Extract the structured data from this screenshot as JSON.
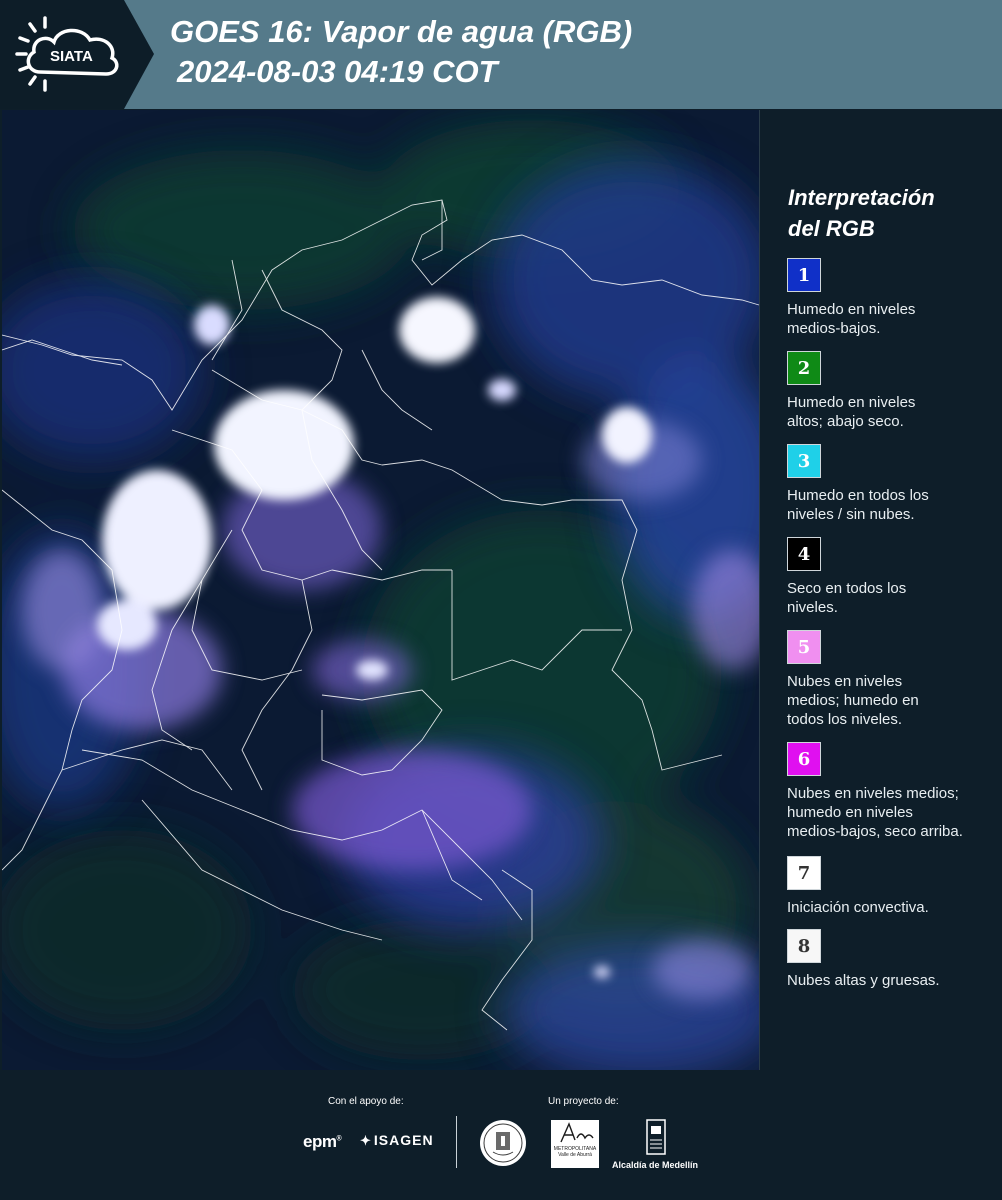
{
  "header": {
    "logo_text": "SIATA",
    "title_line1": "GOES 16: Vapor de agua (RGB)",
    "title_line2": "2024-08-03 04:19 COT"
  },
  "legend": {
    "title_line1": "Interpretación",
    "title_line2": "del RGB",
    "items": [
      {
        "number": "1",
        "color": "#1030c8",
        "text_color": "#ffffff",
        "line1": "Humedo en niveles",
        "line2": "medios-bajos.",
        "line3": ""
      },
      {
        "number": "2",
        "color": "#0f8a16",
        "text_color": "#ffffff",
        "line1": "Humedo en niveles",
        "line2": "altos; abajo seco.",
        "line3": ""
      },
      {
        "number": "3",
        "color": "#1fd0e8",
        "text_color": "#ffffff",
        "line1": "Humedo en todos los",
        "line2": "niveles / sin nubes.",
        "line3": ""
      },
      {
        "number": "4",
        "color": "#000000",
        "text_color": "#ffffff",
        "line1": "Seco en todos los",
        "line2": "niveles.",
        "line3": ""
      },
      {
        "number": "5",
        "color": "#f08ff0",
        "text_color": "#ffffff",
        "line1": "Nubes en niveles",
        "line2": "medios; humedo en",
        "line3": "todos los niveles."
      },
      {
        "number": "6",
        "color": "#e010f0",
        "text_color": "#ffffff",
        "line1": "Nubes en niveles medios;",
        "line2": "humedo en niveles",
        "line3": "medios-bajos, seco arriba."
      },
      {
        "number": "7",
        "color": "#ffffff",
        "text_color": "#333333",
        "line1": "Iniciación convectiva.",
        "line2": "",
        "line3": ""
      },
      {
        "number": "8",
        "color": "#f7f7f7",
        "text_color": "#333333",
        "line1": "Nubes altas y gruesas.",
        "line2": "",
        "line3": ""
      }
    ]
  },
  "footer": {
    "support_label": "Con el apoyo de:",
    "project_label": "Un proyecto de:",
    "epm_text": "epm",
    "isagen_text": "ISAGEN",
    "amva_text": "METROPOLITANA",
    "amva_sub": "Valle de Aburrá",
    "medellin_text": "Alcaldía de Medellín"
  }
}
